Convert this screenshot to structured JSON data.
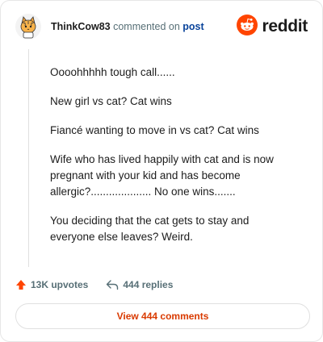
{
  "header": {
    "username": "ThinkCow83",
    "action_text": "commented on",
    "post_link": "post",
    "brand_word": "reddit",
    "avatar_icon": "cat-avatar-icon",
    "brand_icon": "reddit-snoo-icon"
  },
  "comment": {
    "paragraphs": [
      "Oooohhhhh tough call......",
      "New girl vs cat? Cat wins",
      "Fiancé wanting to move in vs cat? Cat wins",
      "Wife who has lived happily with cat and is now pregnant with your kid and has become allergic?.................... No one wins.......",
      "You deciding that the cat gets to stay and everyone else leaves? Weird."
    ]
  },
  "footer": {
    "upvotes_label": "13K upvotes",
    "replies_label": "444 replies",
    "upvote_icon": "upvote-arrow-icon",
    "reply_icon": "reply-arrow-icon"
  },
  "view_button": {
    "label": "View 444 comments"
  },
  "colors": {
    "accent": "#d93a00",
    "upvote": "#ff4500",
    "link": "#0a449b",
    "muted": "#576f76"
  }
}
